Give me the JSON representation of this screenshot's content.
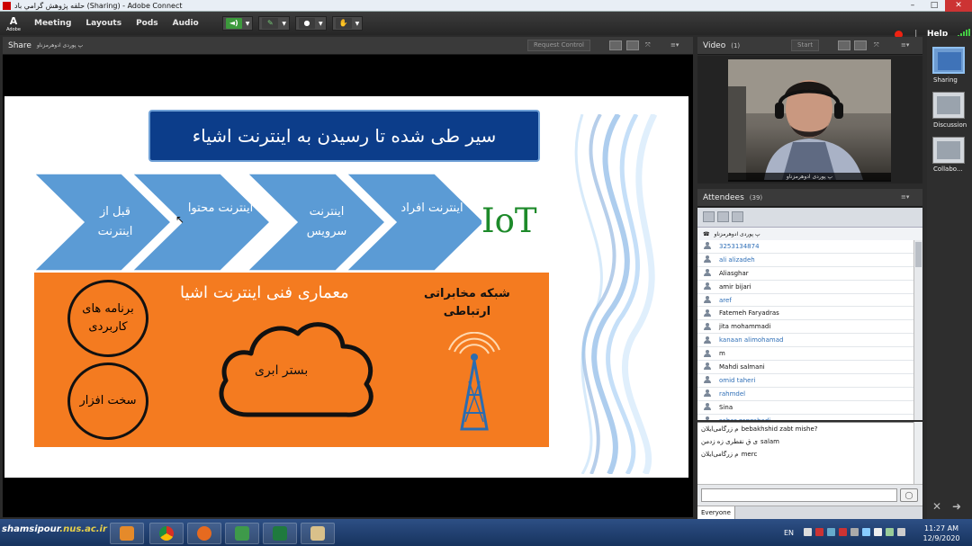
{
  "window": {
    "title": "حلقه پژوهش گرامي باد (Sharing) - Adobe Connect",
    "logo_text": "Adobe"
  },
  "menu": {
    "items": [
      "Meeting",
      "Layouts",
      "Pods",
      "Audio"
    ],
    "help": "Help"
  },
  "share_pod": {
    "title": "Share",
    "presenter": "پ پوردی ادوهرمزناو",
    "request_control": "Request Control"
  },
  "slide": {
    "title": "سیر طی شده تا رسیدن به اینترنت اشیاء",
    "iot_label": "IoT",
    "chevrons": [
      {
        "line1": "قبل از",
        "line2": "اینترنت"
      },
      {
        "line1": "اینترنت محتوا",
        "line2": ""
      },
      {
        "line1": "اینترنت",
        "line2": "سرویس"
      },
      {
        "line1": "اینترنت افراد",
        "line2": ""
      }
    ],
    "architecture_title": "معماری فنی اینترنت اشیا",
    "telecom_line1": "شبکه مخابراتی",
    "telecom_line2": "ارتباطی",
    "apps_line1": "برنامه های",
    "apps_line2": "کاربردی",
    "hardware": "سخت افزار",
    "cloud": "بستر ابری"
  },
  "video_pod": {
    "title": "Video",
    "count": "(1)",
    "start": "Start",
    "caption": "پ پوردی ادوهرمزناو"
  },
  "attendees_pod": {
    "title": "Attendees",
    "count": "(39)",
    "host_row": "پ پوردی ادوهرمزناو",
    "list": [
      {
        "name": "3253134874",
        "blue": true
      },
      {
        "name": "ali alizadeh",
        "blue": true
      },
      {
        "name": "Aliasghar",
        "blue": false
      },
      {
        "name": "amir bijari",
        "blue": false
      },
      {
        "name": "aref",
        "blue": true
      },
      {
        "name": "Fatemeh Faryadras",
        "blue": false
      },
      {
        "name": "jita mohammadi",
        "blue": false
      },
      {
        "name": "kanaan alimohamad",
        "blue": true
      },
      {
        "name": "m",
        "blue": false
      },
      {
        "name": "Mahdi salmani",
        "blue": false
      },
      {
        "name": "omid taheri",
        "blue": true
      },
      {
        "name": "rahmdel",
        "blue": true
      },
      {
        "name": "Sina",
        "blue": false
      },
      {
        "name": "sahar zanzabadi",
        "blue": true
      }
    ]
  },
  "chat": {
    "messages": [
      {
        "sender": "م زرگامی‌ایلان",
        "text": "bebakhshid zabt mishe?"
      },
      {
        "sender": "ی ق نقطر‌ی زه زدمن",
        "text": "salam"
      },
      {
        "sender": "م زرگامی‌ایلان",
        "text": "merc"
      }
    ],
    "send": "Send",
    "tab": "Everyone"
  },
  "layouts": {
    "items": [
      "Sharing",
      "Discussion",
      "Collabo..."
    ]
  },
  "taskbar": {
    "site_label_prefix": "shamsipour",
    "site_label_suffix": ".nus.ac.ir",
    "lang": "EN",
    "time": "11:27 AM",
    "date": "12/9/2020"
  }
}
